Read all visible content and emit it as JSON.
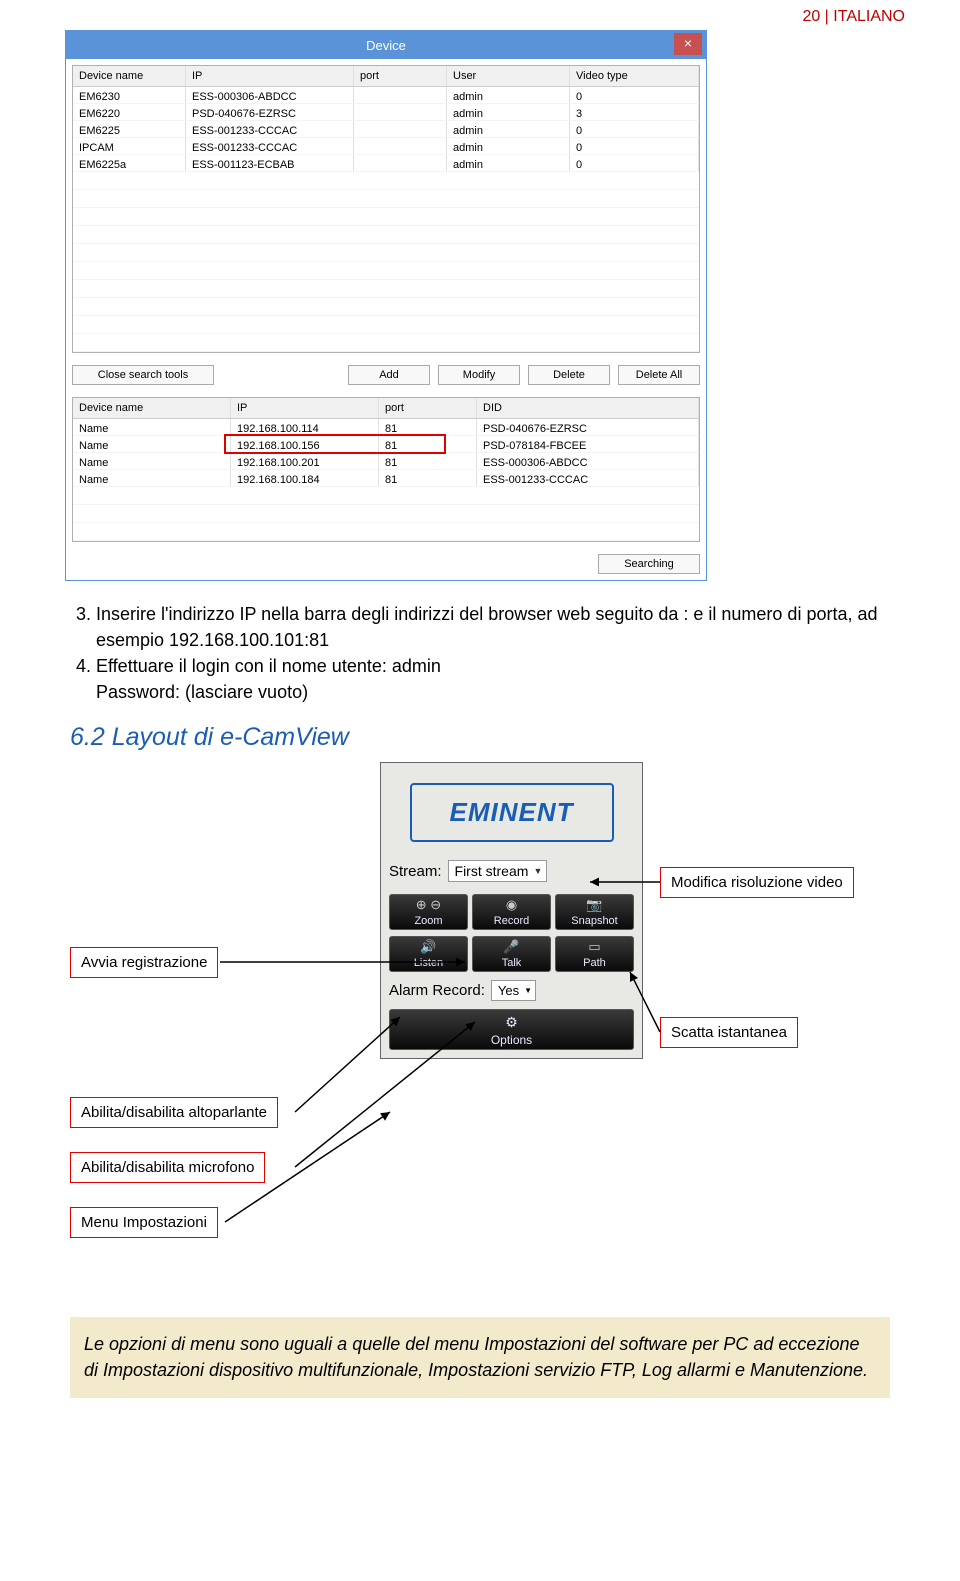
{
  "page_number_header": "20 | ITALIANO",
  "dialog": {
    "title": "Device",
    "close": "×",
    "upper_grid": {
      "headers": [
        "Device name",
        "IP",
        "port",
        "User",
        "Video type"
      ],
      "rows": [
        [
          "EM6230",
          "ESS-000306-ABDCC",
          "",
          "admin",
          "0"
        ],
        [
          "EM6220",
          "PSD-040676-EZRSC",
          "",
          "admin",
          "3"
        ],
        [
          "EM6225",
          "ESS-001233-CCCAC",
          "",
          "admin",
          "0"
        ],
        [
          "IPCAM",
          "ESS-001233-CCCAC",
          "",
          "admin",
          "0"
        ],
        [
          "EM6225a",
          "ESS-001123-ECBAB",
          "",
          "admin",
          "0"
        ]
      ]
    },
    "buttons": {
      "close_search": "Close search tools",
      "add": "Add",
      "modify": "Modify",
      "delete": "Delete",
      "delete_all": "Delete All",
      "searching": "Searching"
    },
    "lower_grid": {
      "headers": [
        "Device name",
        "IP",
        "port",
        "DID"
      ],
      "rows": [
        [
          "Name",
          "192.168.100.114",
          "81",
          "PSD-040676-EZRSC"
        ],
        [
          "Name",
          "192.168.100.156",
          "81",
          "PSD-078184-FBCEE"
        ],
        [
          "Name",
          "192.168.100.201",
          "81",
          "ESS-000306-ABDCC"
        ],
        [
          "Name",
          "192.168.100.184",
          "81",
          "ESS-001233-CCCAC"
        ]
      ]
    }
  },
  "instructions": {
    "item3": "Inserire l'indirizzo IP nella barra degli indirizzi del browser web seguito da : e il numero di porta, ad esempio 192.168.100.101:81",
    "item4_line1": "Effettuare il login con il nome utente: admin",
    "item4_line2": "Password: (lasciare vuoto)"
  },
  "section_heading": "6.2 Layout di e-CamView",
  "camview": {
    "logo": "EMINENT",
    "stream_label": "Stream:",
    "stream_value": "First stream",
    "row1": {
      "zoom": "Zoom",
      "record": "Record",
      "snapshot": "Snapshot"
    },
    "row2": {
      "listen": "Listen",
      "talk": "Talk",
      "path": "Path"
    },
    "alarm_label": "Alarm Record:",
    "alarm_value": "Yes",
    "options": "Options"
  },
  "callouts": {
    "resolution": "Modifica risoluzione video",
    "start_rec": "Avvia registrazione",
    "snapshot": "Scatta istantanea",
    "speaker": "Abilita/disabilita altoparlante",
    "mic": "Abilita/disabilita microfono",
    "settings": "Menu Impostazioni"
  },
  "footer_note": "Le opzioni di menu sono uguali a quelle del menu Impostazioni del software per PC ad eccezione di Impostazioni dispositivo multifunzionale, Impostazioni servizio FTP, Log allarmi e Manutenzione."
}
